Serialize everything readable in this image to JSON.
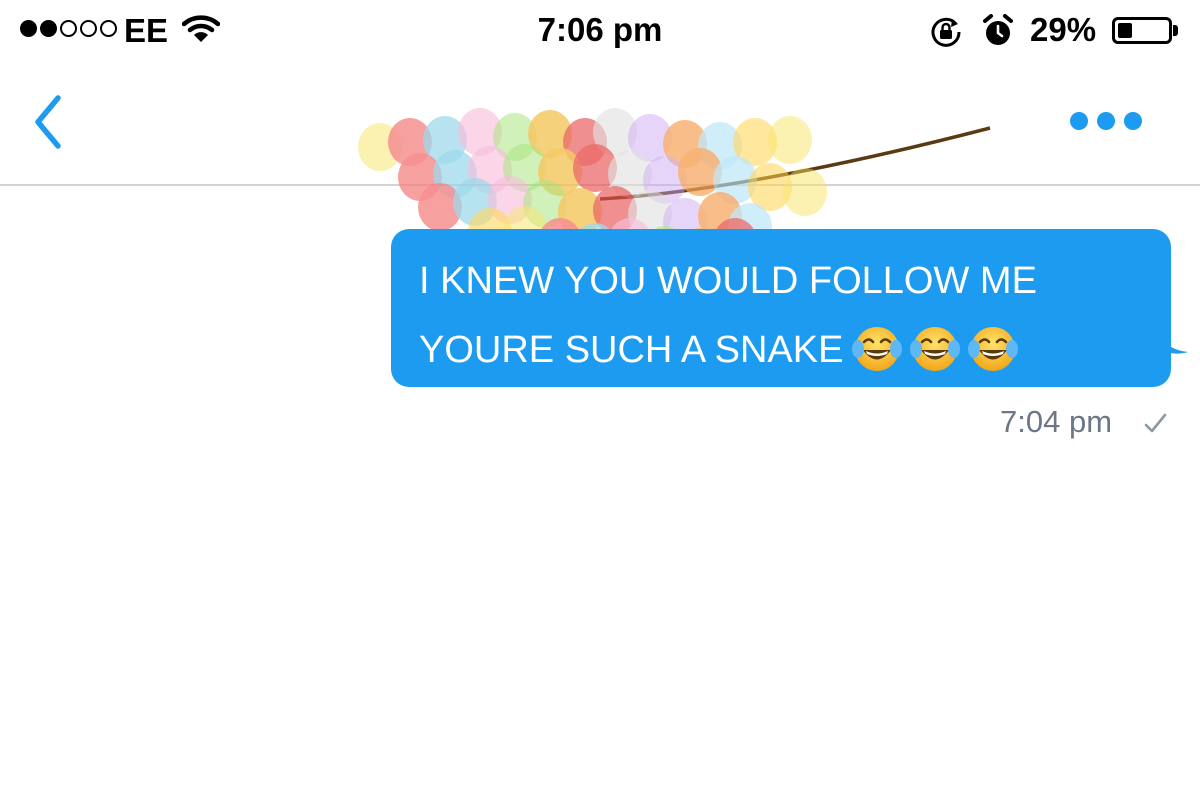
{
  "status_bar": {
    "signal_bars_filled": 2,
    "signal_bars_total": 5,
    "carrier": "EE",
    "wifi_icon": "wifi-icon",
    "time": "7:06 pm",
    "rotation_lock_icon": "rotation-lock-icon",
    "alarm_icon": "alarm-icon",
    "battery_percent_label": "29%",
    "battery_level": 0.29
  },
  "nav_bar": {
    "back_icon": "chevron-left-icon",
    "more_icon": "more-dots-icon",
    "decoration": "balloons-sticker"
  },
  "conversation": {
    "messages": [
      {
        "direction": "outgoing",
        "lines": [
          "I KNEW YOU WOULD FOLLOW ME",
          "YOURE SUCH A SNAKE"
        ],
        "emoji": "face-with-tears-of-joy",
        "emoji_count": 3,
        "time": "7:04 pm",
        "status_icon": "checkmark-icon"
      }
    ]
  },
  "colors": {
    "accent": "#1d9bf0",
    "bubble_text": "#ffffff",
    "timestamp": "#6b7784",
    "divider": "#d4d4d4"
  }
}
